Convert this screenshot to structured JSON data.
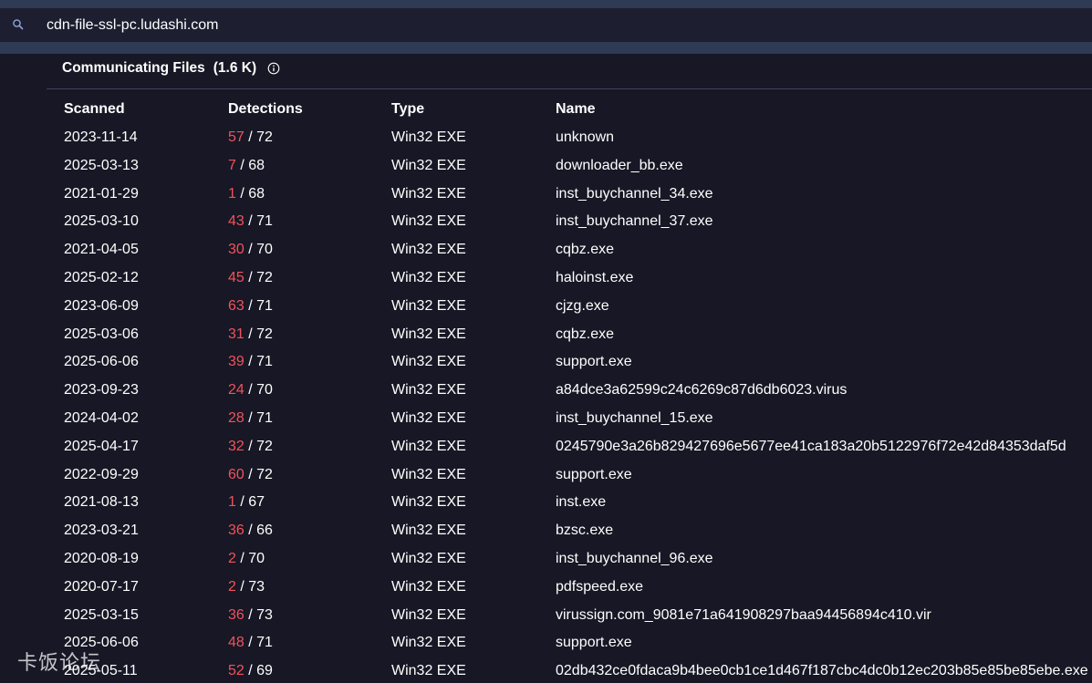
{
  "search": {
    "value": "cdn-file-ssl-pc.ludashi.com",
    "icon": "search-icon"
  },
  "section": {
    "title": "Communicating Files",
    "count": "(1.6 K)",
    "info_icon": "info-icon"
  },
  "table": {
    "headers": {
      "scanned": "Scanned",
      "detections": "Detections",
      "type": "Type",
      "name": "Name"
    },
    "rows": [
      {
        "scanned": "2023-11-14",
        "positives": "57",
        "total": " / 72",
        "type": "Win32 EXE",
        "name": "unknown"
      },
      {
        "scanned": "2025-03-13",
        "positives": "7",
        "total": " / 68",
        "type": "Win32 EXE",
        "name": "downloader_bb.exe"
      },
      {
        "scanned": "2021-01-29",
        "positives": "1",
        "total": " / 68",
        "type": "Win32 EXE",
        "name": "inst_buychannel_34.exe"
      },
      {
        "scanned": "2025-03-10",
        "positives": "43",
        "total": " / 71",
        "type": "Win32 EXE",
        "name": "inst_buychannel_37.exe"
      },
      {
        "scanned": "2021-04-05",
        "positives": "30",
        "total": " / 70",
        "type": "Win32 EXE",
        "name": "cqbz.exe"
      },
      {
        "scanned": "2025-02-12",
        "positives": "45",
        "total": " / 72",
        "type": "Win32 EXE",
        "name": "haloinst.exe"
      },
      {
        "scanned": "2023-06-09",
        "positives": "63",
        "total": " / 71",
        "type": "Win32 EXE",
        "name": "cjzg.exe"
      },
      {
        "scanned": "2025-03-06",
        "positives": "31",
        "total": " / 72",
        "type": "Win32 EXE",
        "name": "cqbz.exe"
      },
      {
        "scanned": "2025-06-06",
        "positives": "39",
        "total": " / 71",
        "type": "Win32 EXE",
        "name": "support.exe"
      },
      {
        "scanned": "2023-09-23",
        "positives": "24",
        "total": " / 70",
        "type": "Win32 EXE",
        "name": "a84dce3a62599c24c6269c87d6db6023.virus"
      },
      {
        "scanned": "2024-04-02",
        "positives": "28",
        "total": " / 71",
        "type": "Win32 EXE",
        "name": "inst_buychannel_15.exe"
      },
      {
        "scanned": "2025-04-17",
        "positives": "32",
        "total": " / 72",
        "type": "Win32 EXE",
        "name": "0245790e3a26b829427696e5677ee41ca183a20b5122976f72e42d84353daf5d"
      },
      {
        "scanned": "2022-09-29",
        "positives": "60",
        "total": " / 72",
        "type": "Win32 EXE",
        "name": "support.exe"
      },
      {
        "scanned": "2021-08-13",
        "positives": "1",
        "total": " / 67",
        "type": "Win32 EXE",
        "name": "inst.exe"
      },
      {
        "scanned": "2023-03-21",
        "positives": "36",
        "total": " / 66",
        "type": "Win32 EXE",
        "name": "bzsc.exe"
      },
      {
        "scanned": "2020-08-19",
        "positives": "2",
        "total": " / 70",
        "type": "Win32 EXE",
        "name": "inst_buychannel_96.exe"
      },
      {
        "scanned": "2020-07-17",
        "positives": "2",
        "total": " / 73",
        "type": "Win32 EXE",
        "name": "pdfspeed.exe"
      },
      {
        "scanned": "2025-03-15",
        "positives": "36",
        "total": " / 73",
        "type": "Win32 EXE",
        "name": "virussign.com_9081e71a641908297baa94456894c410.vir"
      },
      {
        "scanned": "2025-06-06",
        "positives": "48",
        "total": " / 71",
        "type": "Win32 EXE",
        "name": "support.exe"
      },
      {
        "scanned": "2025-05-11",
        "positives": "52",
        "total": " / 69",
        "type": "Win32 EXE",
        "name": "02db432ce0fdaca9b4bee0cb1ce1d467f187cbc4dc0b12ec203b85e85be85ebe.exe"
      }
    ]
  },
  "watermark": "卡饭论坛",
  "colors": {
    "background": "#171725",
    "bar": "#2f3a55",
    "search_bg": "#1d1f31",
    "detection_positive": "#f0535a",
    "divider": "#3c4260"
  }
}
